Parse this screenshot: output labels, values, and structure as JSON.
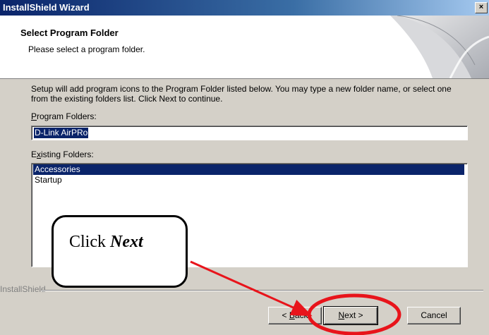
{
  "window": {
    "title": "InstallShield Wizard",
    "close_glyph": "×"
  },
  "header": {
    "title": "Select Program Folder",
    "subtitle": "Please select a program folder."
  },
  "description": "Setup will add program icons to the Program Folder listed below.  You may type a new folder name, or select one from the existing folders list.  Click Next to continue.",
  "program_folders": {
    "label_mnemonic": "P",
    "label_rest": "rogram Folders:",
    "value": "D-Link AirPRo"
  },
  "existing_folders": {
    "label_pre": "E",
    "label_mnemonic": "x",
    "label_rest": "isting Folders:",
    "items": [
      {
        "label": "Accessories",
        "selected": true
      },
      {
        "label": "Startup",
        "selected": false
      }
    ]
  },
  "brand": "InstallShield",
  "buttons": {
    "back": {
      "pre": "< ",
      "mnemonic": "B",
      "rest": "ack"
    },
    "next": {
      "mnemonic": "N",
      "rest": "ext >"
    },
    "cancel": {
      "label": "Cancel"
    }
  },
  "annotation": {
    "text": "Click ",
    "emphasis": "Next",
    "color": "#e8141b"
  }
}
